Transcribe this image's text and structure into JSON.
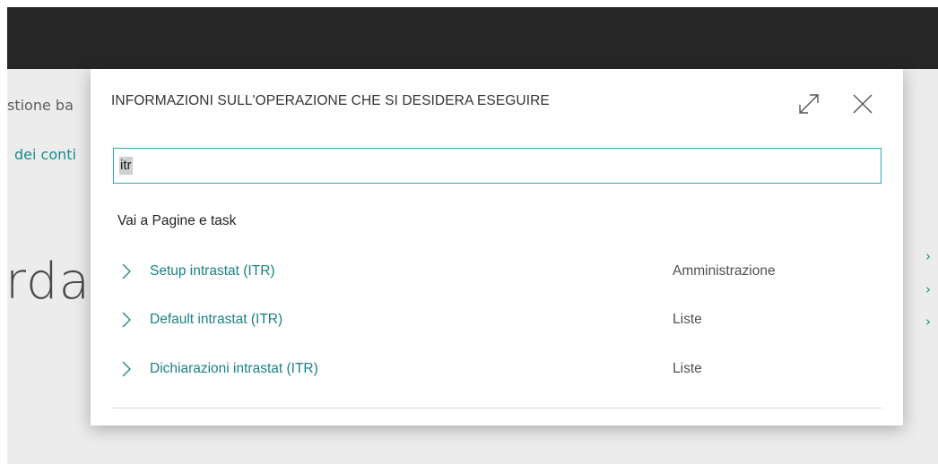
{
  "background": {
    "breadcrumb": "stione ba",
    "link": "dei conti",
    "big_title": "rda"
  },
  "dialog": {
    "title": "INFORMAZIONI SULL'OPERAZIONE CHE SI DESIDERA ESEGUIRE",
    "expand_icon": "expand-icon",
    "close_icon": "close-icon",
    "search": {
      "value": "itr",
      "placeholder": ""
    },
    "section_heading": "Vai a Pagine e task",
    "results": [
      {
        "title": "Setup intrastat (ITR)",
        "category": "Amministrazione"
      },
      {
        "title": "Default intrastat (ITR)",
        "category": "Liste"
      },
      {
        "title": "Dichiarazioni intrastat (ITR)",
        "category": "Liste"
      }
    ]
  },
  "colors": {
    "accent": "#1a8282",
    "app_bar": "#262626",
    "app_background": "#ececec"
  }
}
